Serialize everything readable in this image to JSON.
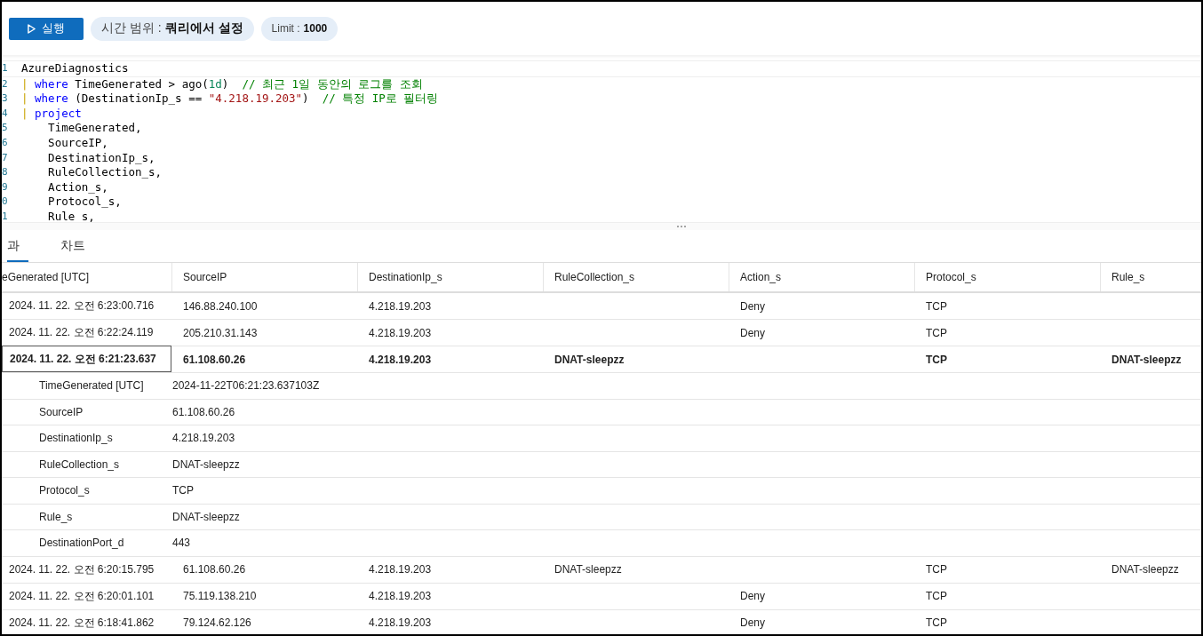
{
  "toolbar": {
    "run_button": {
      "label": "실행"
    },
    "time_range": {
      "label": "시간 범위 :",
      "value": "쿼리에서 설정"
    },
    "limit": {
      "label": "Limit :",
      "value": "1000"
    }
  },
  "editor": {
    "lines": [
      {
        "number": "1",
        "tokens": [
          {
            "kind": "plain",
            "text": "AzureDiagnostics"
          }
        ]
      },
      {
        "number": "2",
        "tokens": [
          {
            "kind": "pipe",
            "text": "| "
          },
          {
            "kind": "keyword",
            "text": "where"
          },
          {
            "kind": "plain",
            "text": " TimeGenerated > ago("
          },
          {
            "kind": "number",
            "text": "1d"
          },
          {
            "kind": "plain",
            "text": ")  "
          },
          {
            "kind": "comment",
            "text": "// 최근 1일 동안의 로그를 조회"
          }
        ]
      },
      {
        "number": "3",
        "tokens": [
          {
            "kind": "pipe",
            "text": "| "
          },
          {
            "kind": "keyword",
            "text": "where"
          },
          {
            "kind": "plain",
            "text": " (DestinationIp_s == "
          },
          {
            "kind": "string",
            "text": "\"4.218.19.203\""
          },
          {
            "kind": "plain",
            "text": ")  "
          },
          {
            "kind": "comment",
            "text": "// 특정 IP로 필터링"
          }
        ]
      },
      {
        "number": "4",
        "tokens": [
          {
            "kind": "pipe",
            "text": "| "
          },
          {
            "kind": "keyword",
            "text": "project"
          }
        ]
      },
      {
        "number": "5",
        "tokens": [
          {
            "kind": "plain",
            "text": "    TimeGenerated,"
          }
        ]
      },
      {
        "number": "6",
        "tokens": [
          {
            "kind": "plain",
            "text": "    SourceIP,"
          }
        ]
      },
      {
        "number": "7",
        "tokens": [
          {
            "kind": "plain",
            "text": "    DestinationIp_s,"
          }
        ]
      },
      {
        "number": "8",
        "tokens": [
          {
            "kind": "plain",
            "text": "    RuleCollection_s,"
          }
        ]
      },
      {
        "number": "9",
        "tokens": [
          {
            "kind": "plain",
            "text": "    Action_s,"
          }
        ]
      },
      {
        "number": "0",
        "tokens": [
          {
            "kind": "plain",
            "text": "    Protocol_s,"
          }
        ]
      },
      {
        "number": "1",
        "tokens": [
          {
            "kind": "plain",
            "text": "    Rule s,"
          }
        ]
      }
    ]
  },
  "result_tabs": [
    {
      "label": "과",
      "selected": true
    },
    {
      "label": "차트",
      "selected": false
    }
  ],
  "table": {
    "columns": [
      "eGenerated [UTC]",
      "SourceIP",
      "DestinationIp_s",
      "RuleCollection_s",
      "Action_s",
      "Protocol_s",
      "Rule_s"
    ],
    "rows": [
      {
        "selected": false,
        "cells": [
          "2024. 11. 22. 오전 6:23:00.716",
          "146.88.240.100",
          "4.218.19.203",
          "",
          "Deny",
          "TCP",
          ""
        ]
      },
      {
        "selected": false,
        "cells": [
          "2024. 11. 22. 오전 6:22:24.119",
          "205.210.31.143",
          "4.218.19.203",
          "",
          "Deny",
          "TCP",
          ""
        ]
      },
      {
        "selected": true,
        "cells": [
          "2024. 11. 22. 오전 6:21:23.637",
          "61.108.60.26",
          "4.218.19.203",
          "DNAT-sleepzz",
          "",
          "TCP",
          "DNAT-sleepzz"
        ],
        "details": [
          {
            "field": "TimeGenerated [UTC]",
            "value": "2024-11-22T06:21:23.637103Z"
          },
          {
            "field": "SourceIP",
            "value": "61.108.60.26"
          },
          {
            "field": "DestinationIp_s",
            "value": "4.218.19.203"
          },
          {
            "field": "RuleCollection_s",
            "value": "DNAT-sleepzz"
          },
          {
            "field": "Protocol_s",
            "value": "TCP"
          },
          {
            "field": "Rule_s",
            "value": "DNAT-sleepzz"
          },
          {
            "field": "DestinationPort_d",
            "value": "443"
          }
        ]
      },
      {
        "selected": false,
        "cells": [
          "2024. 11. 22. 오전 6:20:15.795",
          "61.108.60.26",
          "4.218.19.203",
          "DNAT-sleepzz",
          "",
          "TCP",
          "DNAT-sleepzz"
        ]
      },
      {
        "selected": false,
        "cells": [
          "2024. 11. 22. 오전 6:20:01.101",
          "75.119.138.210",
          "4.218.19.203",
          "",
          "Deny",
          "TCP",
          ""
        ]
      },
      {
        "selected": false,
        "cells": [
          "2024. 11. 22. 오전 6:18:41.862",
          "79.124.62.126",
          "4.218.19.203",
          "",
          "Deny",
          "TCP",
          ""
        ]
      }
    ]
  }
}
